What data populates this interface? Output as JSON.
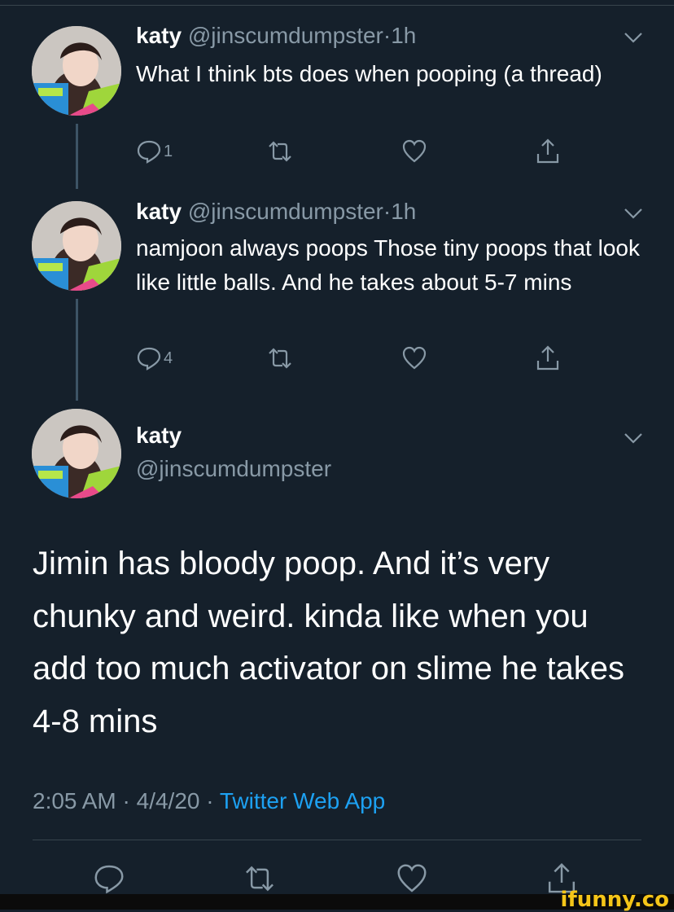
{
  "tweets": [
    {
      "name": "katy",
      "handle": "@jinscumdumpster",
      "separator": "·",
      "time": "1h",
      "text": "What I think bts does when pooping (a thread)",
      "reply_count": "1"
    },
    {
      "name": "katy",
      "handle": "@jinscumdumpster",
      "separator": "·",
      "time": "1h",
      "text": "namjoon always poops Those tiny poops that look like little balls. And he takes about 5-7 mins",
      "reply_count": "4"
    }
  ],
  "main": {
    "name": "katy",
    "handle": "@jinscumdumpster",
    "text": "Jimin has bloody poop. And it’s very chunky and weird. kinda like when you add too much activator on slime he takes 4-8 mins",
    "time": "2:05 AM",
    "sep1": " · ",
    "date": "4/4/20",
    "sep2": " · ",
    "source": "Twitter Web App"
  },
  "watermark": "ifunny.co",
  "icons": {
    "reply": "reply-icon",
    "retweet": "retweet-icon",
    "like": "heart-icon",
    "share": "share-icon",
    "more": "chevron-down-icon"
  },
  "colors": {
    "background": "#15202b",
    "secondary_text": "#8899a6",
    "link": "#1da1f2",
    "thread_line": "#3d5466"
  }
}
